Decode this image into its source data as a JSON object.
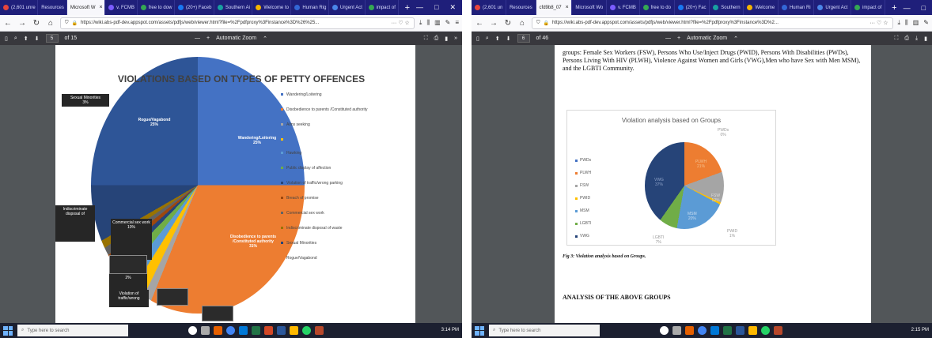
{
  "left_window": {
    "tabs": [
      "(2,601 unre",
      "Resources",
      "Microsoft W",
      "v. FCMB",
      "free to dow",
      "(20+) Faceb",
      "Southern Ai",
      "Welcome to",
      "Human Rig",
      "Urgent Act",
      "impact of"
    ],
    "active_tab_index": 2,
    "url": "https://wiki.abs-pdf-dev.appspot.com/assets/pdfjs/web/viewer.html?file=%2Fpdfproxy%3Finstance%3D%26%25...",
    "page_current": "5",
    "page_total": "of 15",
    "zoom": "Automatic Zoom",
    "chart": {
      "title": "VIOLATIONS BASED ON TYPES OF PETTY OFFENCES",
      "labels": [
        {
          "name": "Sexual Minorities",
          "value": "3%"
        },
        {
          "name": "Rogue/Vagabond",
          "value": "25%"
        },
        {
          "name": "Wandering/Loitering",
          "value": "25%"
        },
        {
          "name": "Indiscriminate disposal of",
          "value": ""
        },
        {
          "name": "Commercial sex work",
          "value": "10%"
        },
        {
          "name": "Disobedience to parents /Constituted authority",
          "value": "31%"
        },
        {
          "name": "",
          "value": "2%"
        },
        {
          "name": "Violation of traffic/wrong",
          "value": ""
        }
      ],
      "legend": [
        {
          "label": "Wandering/Loitering",
          "color": "#4472c4"
        },
        {
          "label": "Disobedience to parents /Constituted authority",
          "color": "#ed7d31"
        },
        {
          "label": "Alms seeking",
          "color": "#a5a5a5"
        },
        {
          "label": "",
          "color": "#ffc000"
        },
        {
          "label": "Hawking",
          "color": "#5b9bd5"
        },
        {
          "label": "Public display of affection",
          "color": "#70ad47"
        },
        {
          "label": "Violation of traffic/wrong parking",
          "color": "#264478"
        },
        {
          "label": "Breach of promise",
          "color": "#9e480e"
        },
        {
          "label": "Commercial sex work",
          "color": "#636363"
        },
        {
          "label": "Indiscriminate disposal of waste",
          "color": "#997300"
        },
        {
          "label": "Sexual Minorities",
          "color": "#264478"
        },
        {
          "label": "Rogue/Vagabond",
          "color": "#2e5597"
        }
      ]
    },
    "search_placeholder": "Type here to search",
    "clock_time": "3:14 PM"
  },
  "right_window": {
    "tabs": [
      "(2,601 un",
      "Resources",
      "cfd9b8_07",
      "Microsoft Wo",
      "v. FCMB",
      "free to do",
      "(20+) Fac",
      "Southern",
      "Welcome",
      "Human Ri",
      "Urgent Act",
      "impact of"
    ],
    "active_tab_index": 2,
    "url": "https://wiki.abs-pdf-dev.appspot.com/assets/pdfjs/web/viewer.html?file=%2Fpdfproxy%3Finstance%3D%2...",
    "page_current": "6",
    "page_total": "of 46",
    "zoom": "Automatic Zoom",
    "doc_text": "groups: Female Sex Workers (FSW), Persons Who Use/Inject Drugs (PWID), Persons With Disabilities (PWDs), Persons Living With HIV (PLWH), Violence Against Women and Girls (VWG),Men who have Sex with Men MSM), and the LGBTI Community.",
    "chart": {
      "title": "Violation analysis based on Groups",
      "legend": [
        "PWDs",
        "PLWH",
        "FSW",
        "PWID",
        "MSM",
        "LGBTI",
        "VWG"
      ],
      "labels": [
        {
          "name": "PWDs",
          "value": "0%"
        },
        {
          "name": "PLWH",
          "value": "21%"
        },
        {
          "name": "FSW",
          "value": "12%"
        },
        {
          "name": "PWID",
          "value": "1%"
        },
        {
          "name": "MSM",
          "value": "20%"
        },
        {
          "name": "LGBTI",
          "value": "7%"
        },
        {
          "name": "VWG",
          "value": "37%"
        }
      ]
    },
    "caption": "Fig 3: Violation analysis based on Groups.",
    "heading": "ANALYSIS OF THE ABOVE GROUPS",
    "search_placeholder": "Type here to search",
    "clock_time": "2:15 PM"
  }
}
